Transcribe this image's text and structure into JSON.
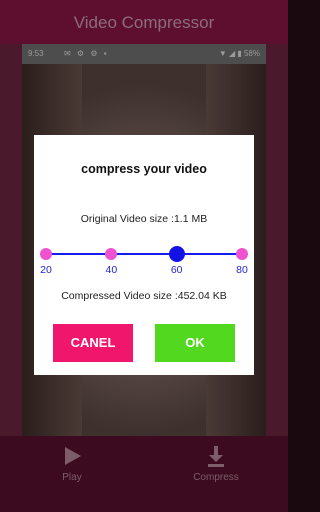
{
  "app": {
    "title": "Video Compressor"
  },
  "statusbar": {
    "time": "9:53",
    "icons": "✉ ⚙ ⚙ ▪",
    "battery": "▼ ◢ ▮ 58%"
  },
  "bottom_nav": {
    "play_label": "Play",
    "compress_label": "Compress"
  },
  "dialog": {
    "title": "compress your video",
    "original_size": "Original Video size :1.1 MB",
    "slider": {
      "ticks": [
        "20",
        "40",
        "60",
        "80"
      ],
      "selected": "60"
    },
    "compressed_size": "Compressed Video size :452.04 KB",
    "cancel_label": "CANEL",
    "ok_label": "OK"
  },
  "colors": {
    "accent": "#ef166c",
    "ok": "#52d91f",
    "slider_track": "#1a1aee",
    "tick": "#f051d0",
    "thumb": "#1212e6"
  }
}
